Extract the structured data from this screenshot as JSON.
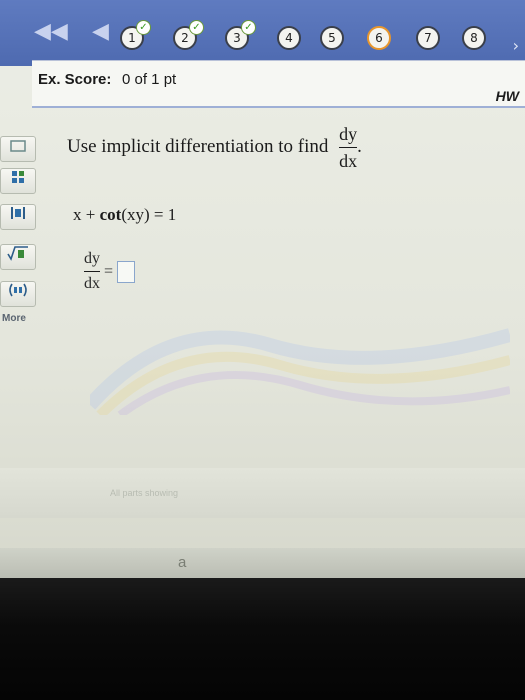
{
  "nav": {
    "back_all": "◀◀",
    "back": "◀",
    "forward": "›",
    "questions": [
      {
        "label": "1",
        "done": true
      },
      {
        "label": "2",
        "done": true
      },
      {
        "label": "3",
        "done": true
      },
      {
        "label": "4",
        "done": false
      },
      {
        "label": "5",
        "done": false
      },
      {
        "label": "6",
        "done": false,
        "current": true
      },
      {
        "label": "7",
        "done": false
      },
      {
        "label": "8",
        "done": false
      }
    ],
    "check_mark": "✓"
  },
  "score": {
    "label": "Ex. Score:",
    "value": "0 of 1 pt",
    "hw": "HW"
  },
  "tools": {
    "more": "More"
  },
  "question": {
    "prompt": "Use implicit differentiation to find",
    "frac_num": "dy",
    "frac_den": "dx",
    "period": ".",
    "equation_left": "x + ",
    "equation_func": "cot",
    "equation_right": "(xy) = 1"
  },
  "answer": {
    "num": "dy",
    "den": "dx",
    "equals": "="
  },
  "footer": {
    "faded_text": "All parts showing",
    "taskbar_letter": "a"
  }
}
